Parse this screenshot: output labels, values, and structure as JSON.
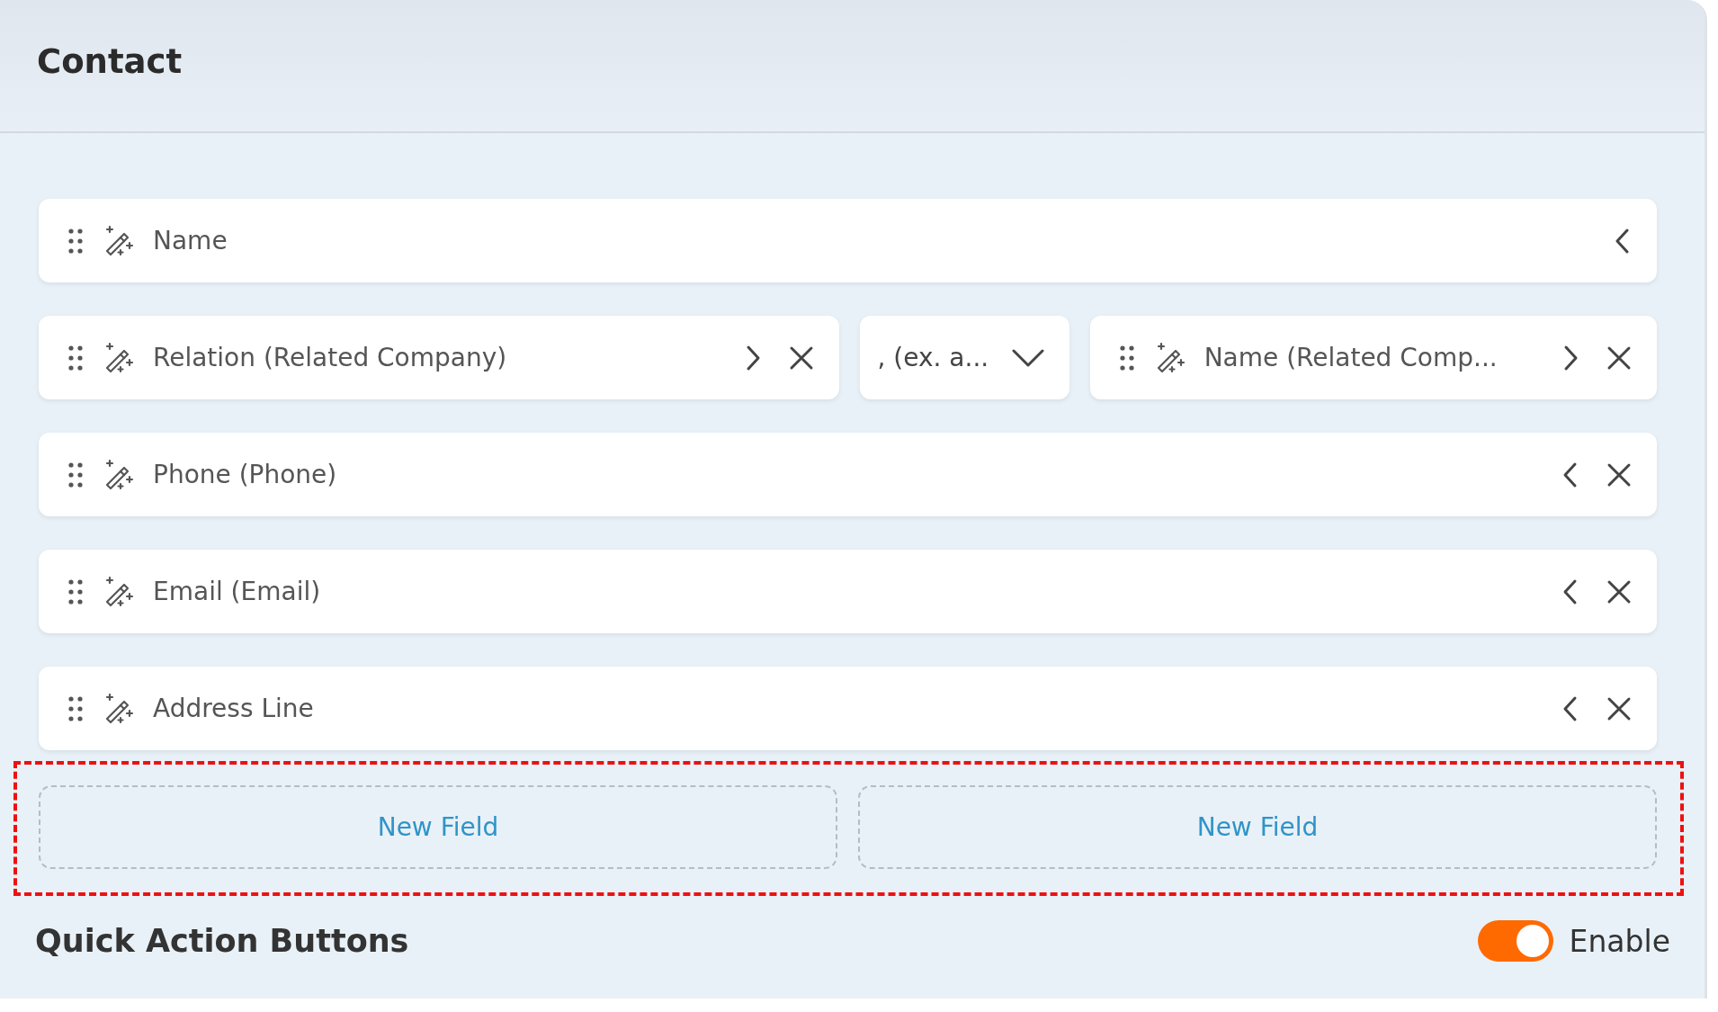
{
  "header": {
    "title": "Contact"
  },
  "rows": [
    {
      "items": [
        {
          "kind": "field",
          "label": "Name",
          "expanded": false,
          "removable": false
        }
      ]
    },
    {
      "items": [
        {
          "kind": "field",
          "label": "Relation (Related Company)",
          "expanded": true,
          "removable": true
        },
        {
          "kind": "select",
          "value": ", (ex. a..."
        },
        {
          "kind": "field",
          "label": "Name (Related Comp...",
          "expanded": true,
          "removable": true
        }
      ]
    },
    {
      "items": [
        {
          "kind": "field",
          "label": "Phone (Phone)",
          "expanded": false,
          "removable": true
        }
      ]
    },
    {
      "items": [
        {
          "kind": "field",
          "label": "Email (Email)",
          "expanded": false,
          "removable": true
        }
      ]
    },
    {
      "items": [
        {
          "kind": "field",
          "label": "Address Line",
          "expanded": false,
          "removable": true
        }
      ]
    }
  ],
  "new_fields": {
    "highlighted": true,
    "buttons": [
      "New Field",
      "New Field"
    ]
  },
  "quick_actions": {
    "title": "Quick Action Buttons",
    "toggle": {
      "on": true,
      "label": "Enable"
    }
  }
}
